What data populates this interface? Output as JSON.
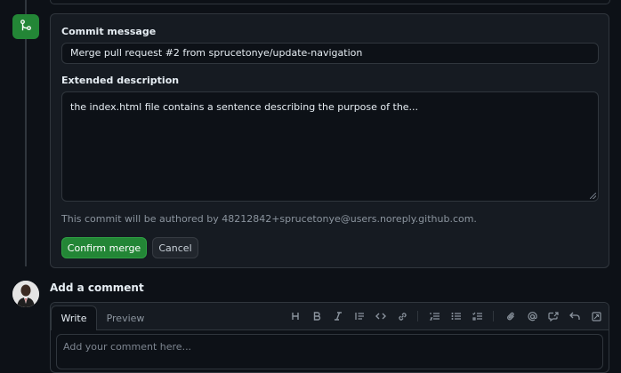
{
  "merge_form": {
    "commit_message_label": "Commit message",
    "commit_message_value": "Merge pull request #2 from sprucetonye/update-navigation",
    "extended_description_label": "Extended description",
    "extended_description_value": "the index.html file contains a sentence describing the purpose of the...",
    "author_note": "This commit will be authored by 48212842+sprucetonye@users.noreply.github.com.",
    "confirm_label": "Confirm merge",
    "cancel_label": "Cancel"
  },
  "comment": {
    "title": "Add a comment",
    "tabs": [
      "Write",
      "Preview"
    ],
    "placeholder": "Add your comment here...",
    "toolbar_icons": [
      "heading-icon",
      "bold-icon",
      "italic-icon",
      "quote-icon",
      "code-icon",
      "link-icon",
      "ordered-list-icon",
      "unordered-list-icon",
      "task-list-icon",
      "attach-icon",
      "mention-icon",
      "reference-icon",
      "reply-icon",
      "fullscreen-icon"
    ]
  },
  "colors": {
    "background": "#0d1117",
    "panel": "#161b22",
    "border": "#30363d",
    "success": "#238636",
    "muted_text": "#8b949e"
  }
}
